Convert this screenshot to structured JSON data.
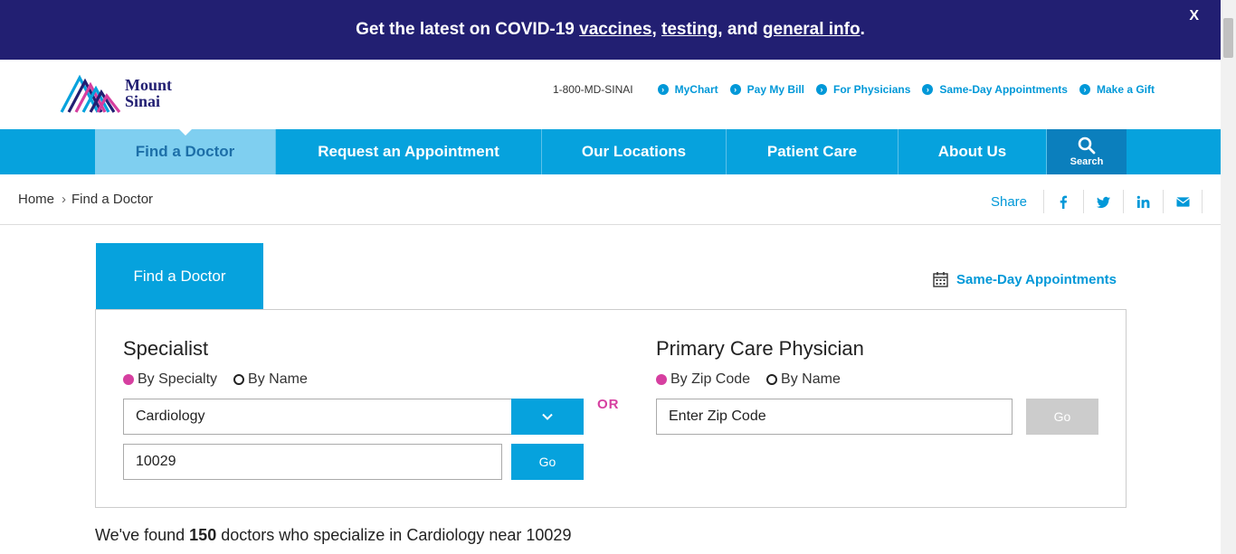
{
  "banner": {
    "prefix": "Get the latest on COVID-19 ",
    "link_vaccines": "vaccines",
    "sep1": ", ",
    "link_testing": "testing",
    "sep2": ", and ",
    "link_general": "general info",
    "suffix": ".",
    "close_label": "X",
    "background": "#221f72"
  },
  "logo": {
    "line1": "Mount",
    "line2": "Sinai"
  },
  "utility": {
    "phone": "1-800-MD-SINAI",
    "links": [
      "MyChart",
      "Pay My Bill",
      "For Physicians",
      "Same-Day Appointments",
      "Make a Gift"
    ]
  },
  "nav": {
    "items": [
      "Find a Doctor",
      "Request an Appointment",
      "Our Locations",
      "Patient Care",
      "About Us"
    ],
    "active": "Find a Doctor",
    "search_label": "Search",
    "color": "#06a2dd"
  },
  "breadcrumb": {
    "home": "Home",
    "current": "Find a Doctor"
  },
  "share": {
    "label": "Share",
    "icons": [
      "facebook-icon",
      "twitter-icon",
      "linkedin-icon",
      "email-icon"
    ]
  },
  "finder": {
    "tab_label": "Find a Doctor",
    "same_day_label": "Same-Day Appointments",
    "specialist": {
      "title": "Specialist",
      "radio_1": "By Specialty",
      "radio_2": "By Name",
      "specialty_value": "Cardiology",
      "zip_value": "10029",
      "go_label": "Go"
    },
    "or_label": "OR",
    "primary": {
      "title": "Primary Care Physician",
      "radio_1": "By Zip Code",
      "radio_2": "By Name",
      "zip_placeholder": "Enter Zip Code",
      "go_label": "Go"
    }
  },
  "results": {
    "prefix": "We've found ",
    "count": "150",
    "suffix": " doctors who specialize in Cardiology near 10029"
  },
  "colors": {
    "accent": "#06a2dd",
    "pink": "#d63fa0",
    "navy": "#221f72"
  }
}
